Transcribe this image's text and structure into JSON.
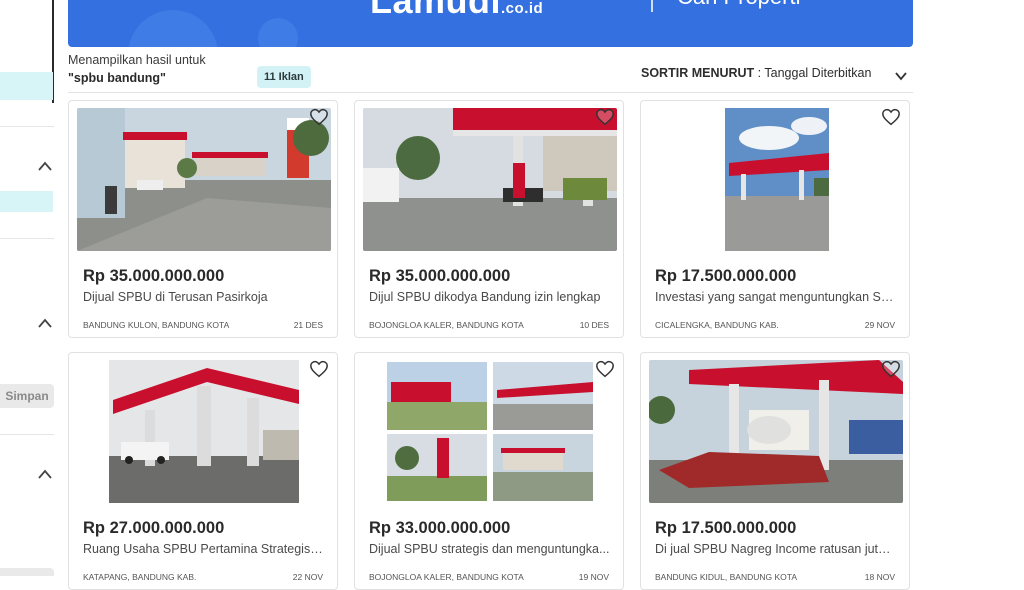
{
  "sidebar": {
    "save_label": "Simpan"
  },
  "banner": {
    "logo_main": "Lamudi",
    "logo_domain": ".co.id",
    "tagline": "Cari Properti"
  },
  "results": {
    "showing_label": "Menampilkan hasil untuk",
    "query": "\"spbu bandung\"",
    "count_badge": "11 Iklan"
  },
  "sort": {
    "label": "SORTIR MENURUT",
    "separator": " : ",
    "value": "Tanggal Diterbitkan"
  },
  "listings": [
    {
      "price": "Rp 35.000.000.000",
      "title": "Dijual SPBU di Terusan Pasirkoja",
      "location": "BANDUNG KULON, BANDUNG KOTA",
      "date": "21 DES"
    },
    {
      "price": "Rp 35.000.000.000",
      "title": "Dijul SPBU dikodya Bandung izin lengkap",
      "location": "BOJONGLOA KALER, BANDUNG KOTA",
      "date": "10 DES"
    },
    {
      "price": "Rp 17.500.000.000",
      "title": "Investasi yang sangat menguntungkan Sp...",
      "location": "CICALENGKA, BANDUNG KAB.",
      "date": "29 NOV"
    },
    {
      "price": "Rp 27.000.000.000",
      "title": "Ruang Usaha SPBU Pertamina Strategis d...",
      "location": "KATAPANG, BANDUNG KAB.",
      "date": "22 NOV"
    },
    {
      "price": "Rp 33.000.000.000",
      "title": "Dijual SPBU strategis dan menguntungka...",
      "location": "BOJONGLOA KALER, BANDUNG KOTA",
      "date": "19 NOV"
    },
    {
      "price": "Rp 17.500.000.000",
      "title": "Di jual SPBU Nagreg Income ratusan juta ...",
      "location": "BANDUNG KIDUL, BANDUNG KOTA",
      "date": "18 NOV"
    }
  ],
  "colors": {
    "brand_blue": "#3470e0",
    "badge_bg": "#d3f2f5",
    "canopy_red": "#c8102e"
  }
}
